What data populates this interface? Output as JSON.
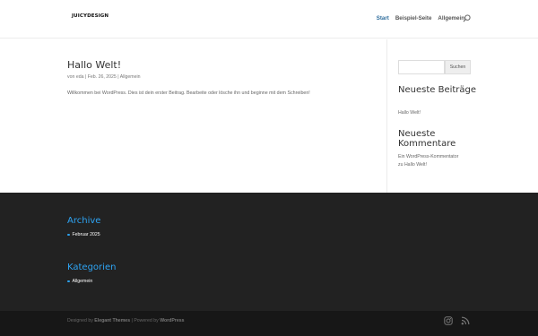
{
  "header": {
    "logo": "JUICYDESIGN",
    "nav": [
      {
        "label": "Start",
        "active": true
      },
      {
        "label": "Beispiel-Seite",
        "active": false
      },
      {
        "label": "Allgemein",
        "active": false
      }
    ]
  },
  "post": {
    "title": "Hallo Welt!",
    "author_prefix": "von",
    "author": "eda",
    "date": "Feb. 26, 2025",
    "category": "Allgemein",
    "excerpt": "Willkommen bei WordPress. Dies ist dein erster Beitrag. Bearbeite oder lösche ihn und beginne mit dem Schreiben!"
  },
  "sidebar": {
    "search_button": "Suchen",
    "recent_posts_title": "Neueste Beiträge",
    "recent_posts": [
      "Hallo Welt!"
    ],
    "recent_comments_title": "Neueste Kommentare",
    "recent_comment_author": "Ein WordPress-Kommentator",
    "recent_comment_on": "zu",
    "recent_comment_post": "Hallo Welt!"
  },
  "footer": {
    "archive_title": "Archive",
    "archive_items": [
      "Februar 2025"
    ],
    "categories_title": "Kategorien",
    "categories_items": [
      "Allgemein"
    ],
    "credits_designed": "Designed by",
    "credits_theme": "Elegant Themes",
    "credits_powered": "| Powered by",
    "credits_wp": "WordPress"
  },
  "colors": {
    "accent": "#2ea3f2",
    "nav_active": "#2d6c9c",
    "footer_bg": "#222222",
    "bottom_bar_bg": "#171717"
  },
  "icons": [
    "search-icon",
    "instagram-icon",
    "rss-icon"
  ]
}
